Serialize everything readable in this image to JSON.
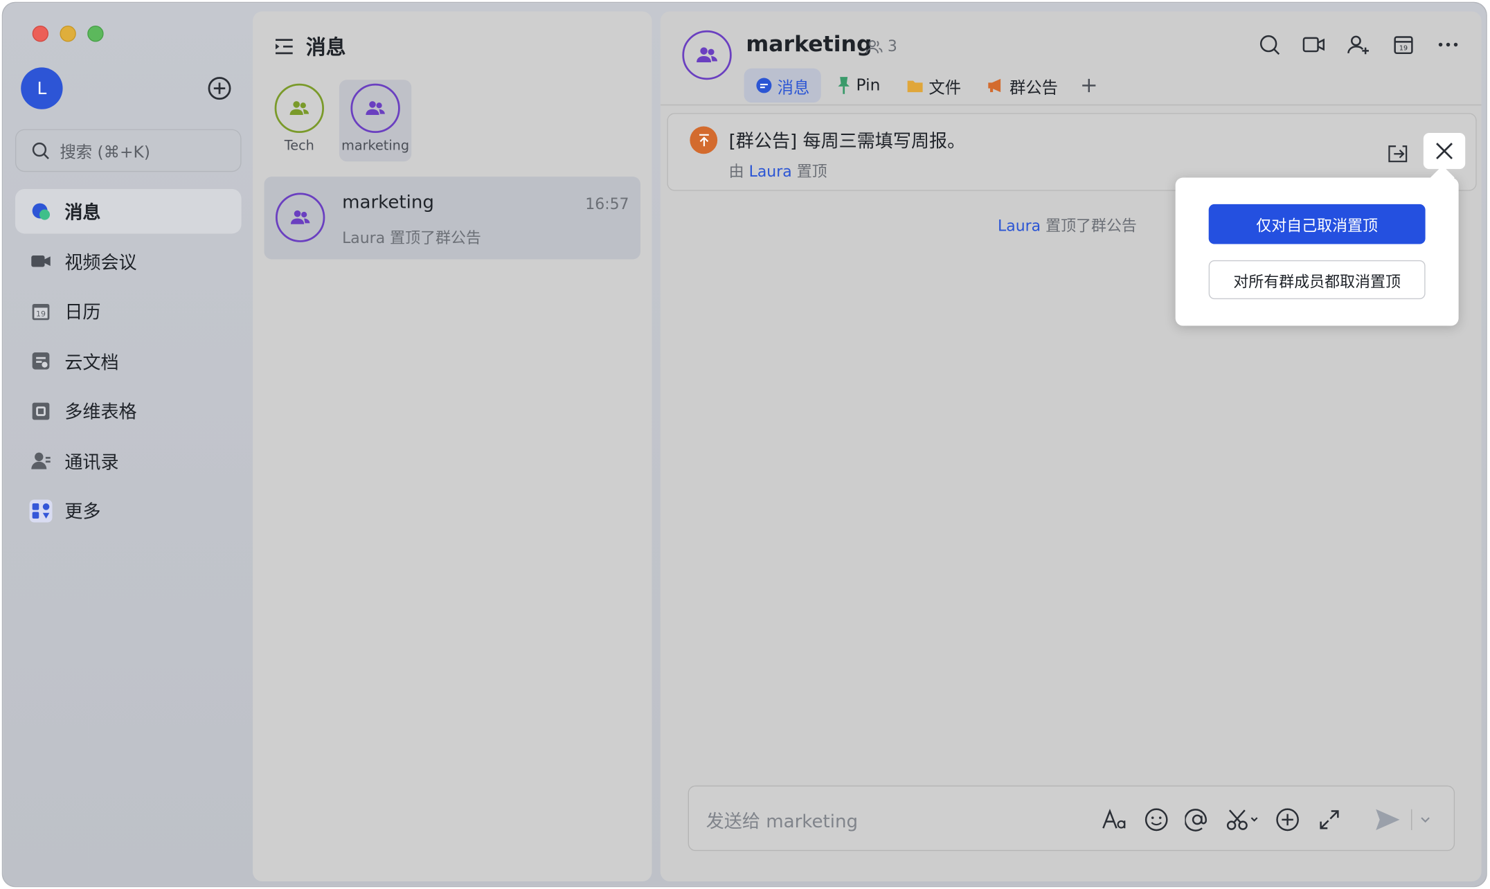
{
  "user": {
    "avatar_letter": "L"
  },
  "search": {
    "placeholder": "搜索 (⌘+K)"
  },
  "nav": {
    "items": [
      {
        "label": "消息",
        "icon": "chat-bubble-icon",
        "active": true
      },
      {
        "label": "视频会议",
        "icon": "video-icon"
      },
      {
        "label": "日历",
        "icon": "calendar-icon"
      },
      {
        "label": "云文档",
        "icon": "doc-icon"
      },
      {
        "label": "多维表格",
        "icon": "base-icon"
      },
      {
        "label": "通讯录",
        "icon": "contacts-icon"
      },
      {
        "label": "更多",
        "icon": "apps-icon"
      }
    ]
  },
  "messages": {
    "title": "消息",
    "pinned_chats": [
      {
        "label": "Tech",
        "color": "#7a9a2a"
      },
      {
        "label": "marketing",
        "color": "#6a3fc0"
      }
    ],
    "chat_list": [
      {
        "name": "marketing",
        "time": "16:57",
        "preview": "Laura 置顶了群公告"
      }
    ]
  },
  "chat": {
    "name": "marketing",
    "member_count": "3",
    "tabs": [
      {
        "label": "消息",
        "icon": "chat-bubble-icon",
        "active": true
      },
      {
        "label": "Pin",
        "icon": "pin-icon"
      },
      {
        "label": "文件",
        "icon": "folder-icon"
      },
      {
        "label": "群公告",
        "icon": "megaphone-icon"
      }
    ],
    "pinned": {
      "text": "[群公告] 每周三需填写周报。",
      "by_prefix": "由",
      "by_user": "Laura",
      "by_suffix": "置顶"
    },
    "system_message": {
      "user": "Laura",
      "text": "置顶了群公告"
    },
    "popover": {
      "option_self": "仅对自己取消置顶",
      "option_all": "对所有群成员都取消置顶"
    },
    "composer": {
      "placeholder": "发送给 marketing"
    }
  },
  "colors": {
    "accent": "#2450e0",
    "purple": "#6a3fc0",
    "orange": "#d36b2e"
  }
}
